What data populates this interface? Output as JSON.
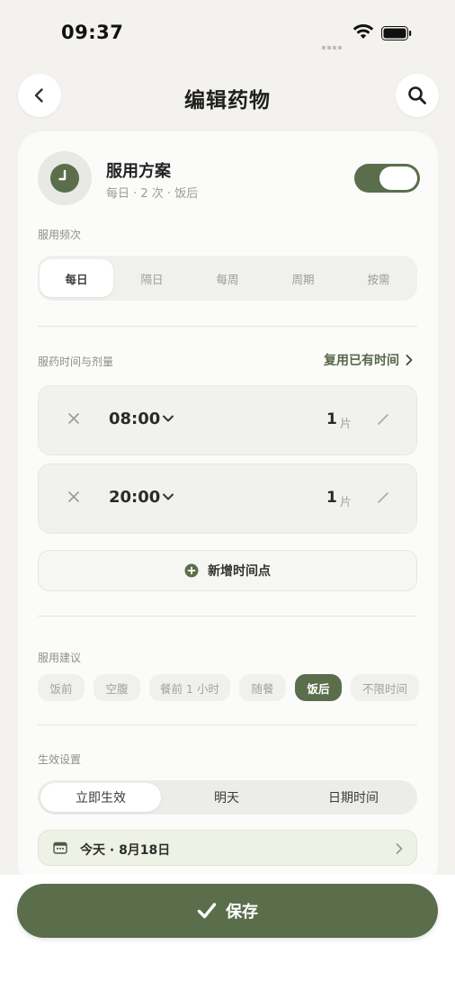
{
  "status_bar": {
    "time": "09:37"
  },
  "nav": {
    "title": "编辑药物",
    "back_icon": "chevron-left-icon",
    "search_icon": "search-icon"
  },
  "plan": {
    "title": "服用方案",
    "subtitle": "每日 · 2 次 · 饭后",
    "enabled": true,
    "icon": "clock-icon"
  },
  "frequency": {
    "label": "服用频次",
    "options": [
      "每日",
      "隔日",
      "每周",
      "周期",
      "按需"
    ],
    "selected": "每日"
  },
  "times": {
    "label": "服药时间与剂量",
    "reuse_link": "复用已有时间",
    "rows": [
      {
        "time": "08:00",
        "dose": "1",
        "unit": "片"
      },
      {
        "time": "20:00",
        "dose": "1",
        "unit": "片"
      }
    ],
    "add_label": "新增时间点"
  },
  "advice": {
    "label": "服用建议",
    "options": [
      "饭前",
      "空腹",
      "餐前 1 小时",
      "随餐",
      "饭后",
      "不限时间"
    ],
    "selected": "饭后"
  },
  "effective": {
    "label": "生效设置",
    "options": [
      "立即生效",
      "明天",
      "日期时间"
    ],
    "selected": "立即生效",
    "date_text": "今天 · 8月18日"
  },
  "save": {
    "label": "保存"
  },
  "colors": {
    "accent": "#5a6e4c",
    "background": "#f3f2ef",
    "card": "#fbfbfa"
  }
}
